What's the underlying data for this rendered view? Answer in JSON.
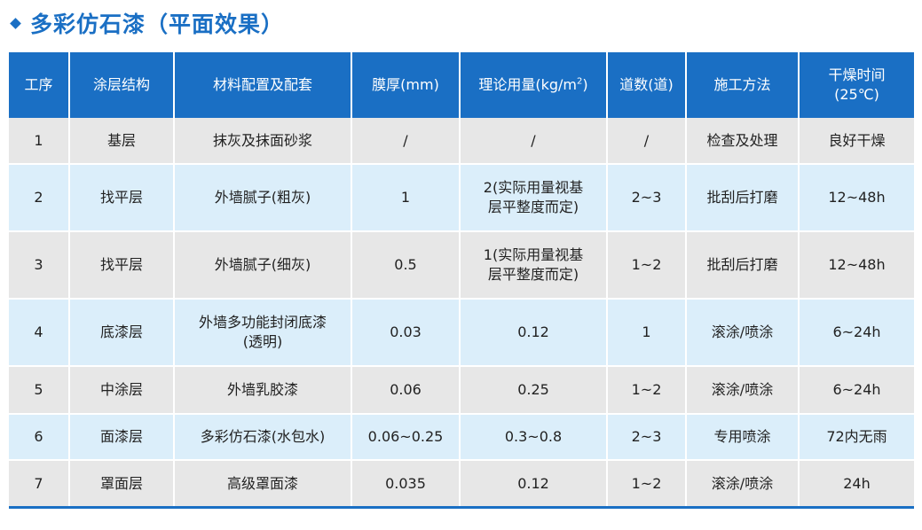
{
  "title": "多彩仿石漆（平面效果）",
  "headers": {
    "step": "工序",
    "layer": "涂层结构",
    "material": "材料配置及配套",
    "thickness": "膜厚(mm)",
    "usage_prefix": "理论用量(kg/m",
    "usage_sup": "2",
    "usage_suffix": ")",
    "passes": "道数(道)",
    "method": "施工方法",
    "dry_line1": "干燥时间",
    "dry_line2": "(25℃)"
  },
  "rows": [
    {
      "step": "1",
      "layer": "基层",
      "material": "抹灰及抹面砂浆",
      "material2": "",
      "thickness": "/",
      "usage": "/",
      "usage2": "",
      "passes": "/",
      "method": "检查及处理",
      "dry": "良好干燥"
    },
    {
      "step": "2",
      "layer": "找平层",
      "material": "外墙腻子(粗灰)",
      "material2": "",
      "thickness": "1",
      "usage": "2(实际用量视基",
      "usage2": "层平整度而定)",
      "passes": "2~3",
      "method": "批刮后打磨",
      "dry": "12~48h"
    },
    {
      "step": "3",
      "layer": "找平层",
      "material": "外墙腻子(细灰)",
      "material2": "",
      "thickness": "0.5",
      "usage": "1(实际用量视基",
      "usage2": "层平整度而定)",
      "passes": "1~2",
      "method": "批刮后打磨",
      "dry": "12~48h"
    },
    {
      "step": "4",
      "layer": "底漆层",
      "material": "外墙多功能封闭底漆",
      "material2": "(透明)",
      "thickness": "0.03",
      "usage": "0.12",
      "usage2": "",
      "passes": "1",
      "method": "滚涂/喷涂",
      "dry": "6~24h"
    },
    {
      "step": "5",
      "layer": "中涂层",
      "material": "外墙乳胶漆",
      "material2": "",
      "thickness": "0.06",
      "usage": "0.25",
      "usage2": "",
      "passes": "1~2",
      "method": "滚涂/喷涂",
      "dry": "6~24h"
    },
    {
      "step": "6",
      "layer": "面漆层",
      "material": "多彩仿石漆(水包水)",
      "material2": "",
      "thickness": "0.06~0.25",
      "usage": "0.3~0.8",
      "usage2": "",
      "passes": "2~3",
      "method": "专用喷涂",
      "dry": "72内无雨"
    },
    {
      "step": "7",
      "layer": "罩面层",
      "material": "高级罩面漆",
      "material2": "",
      "thickness": "0.035",
      "usage": "0.12",
      "usage2": "",
      "passes": "1~2",
      "method": "滚涂/喷涂",
      "dry": "24h"
    }
  ],
  "colors": {
    "accent": "#1a6fc4",
    "row_gray": "#e7e7e7",
    "row_blue": "#dbeefa"
  }
}
